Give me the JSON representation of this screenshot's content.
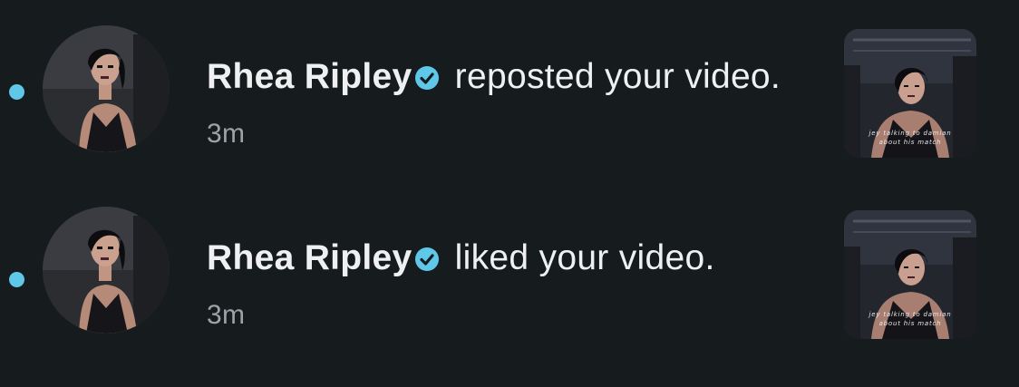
{
  "colors": {
    "background": "#161b1d",
    "unread_dot": "#5fc8e8",
    "verified_badge": "#5fc8e8",
    "primary_text": "#eef0f1",
    "secondary_text": "#9da3a6"
  },
  "notifications": [
    {
      "unread": true,
      "avatar_icon": "user-avatar",
      "user_name": "Rhea Ripley",
      "verified_icon": "verified-badge-icon",
      "action_text": " reposted your video.",
      "time": "3m",
      "thumbnail_caption_1": "jey talking to damian",
      "thumbnail_caption_2": "about his match"
    },
    {
      "unread": true,
      "avatar_icon": "user-avatar",
      "user_name": "Rhea Ripley",
      "verified_icon": "verified-badge-icon",
      "action_text": " liked your video.",
      "time": "3m",
      "thumbnail_caption_1": "jey talking to damian",
      "thumbnail_caption_2": "about his match"
    }
  ]
}
